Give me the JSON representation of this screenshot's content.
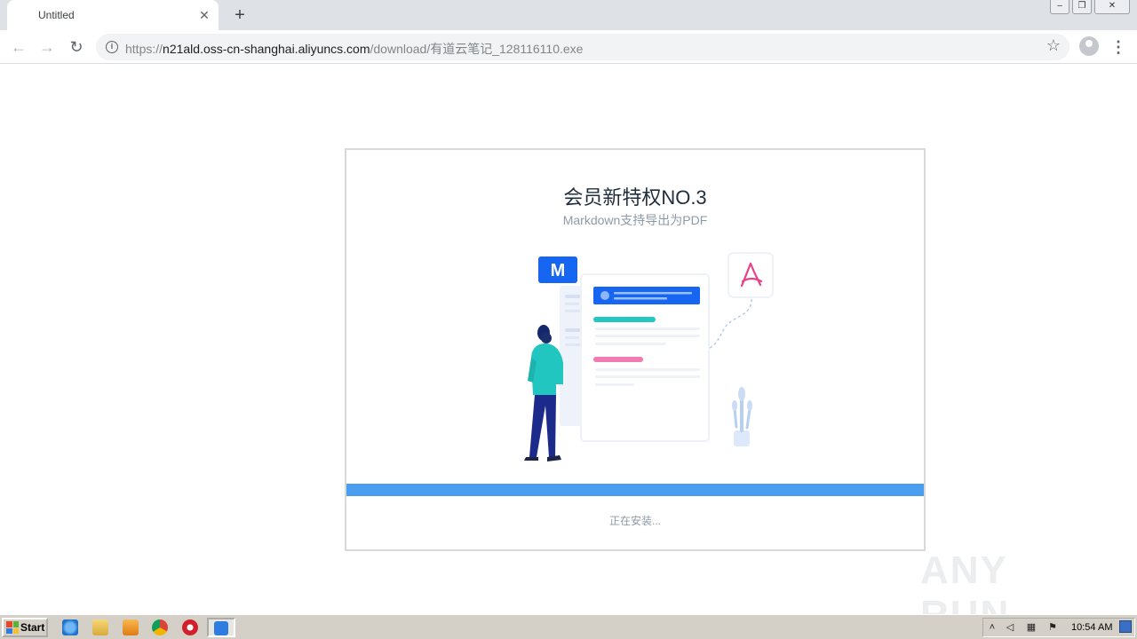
{
  "browser": {
    "tab_title": "Untitled",
    "new_tab_symbol": "+",
    "url_scheme": "https://",
    "url_host": "n21ald.oss-cn-shanghai.aliyuncs.com",
    "url_path": "/download/有道云笔记_128116110.exe"
  },
  "installer": {
    "title": "会员新特权NO.3",
    "subtitle": "Markdown支持导出为PDF",
    "badge_letter": "M",
    "status": "正在安装...",
    "progress_fraction": 1.0,
    "accent_color": "#4a9ef0"
  },
  "watermark": {
    "text": "ANY RUN"
  },
  "taskbar": {
    "start_label": "Start",
    "clock": "10:54 AM"
  }
}
